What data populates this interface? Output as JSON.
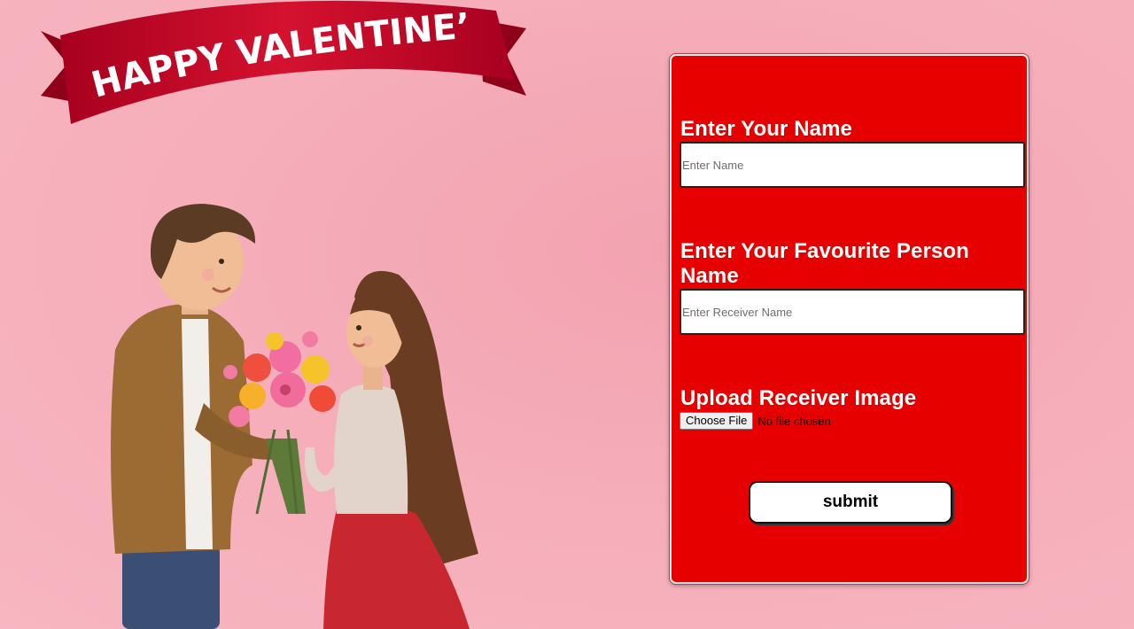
{
  "banner": {
    "text": "HAPPY VALENTINE’S DAY",
    "color": "#c8102e"
  },
  "form": {
    "name_label": "Enter Your Name",
    "name_placeholder": "Enter Name",
    "receiver_label": "Enter Your Favourite Person Name",
    "receiver_placeholder": "Enter Receiver Name",
    "image_label": "Upload Receiver Image",
    "choose_file_label": "Choose File",
    "file_status": "No file chosen",
    "submit_label": "submit",
    "card_color": "#e60000"
  }
}
